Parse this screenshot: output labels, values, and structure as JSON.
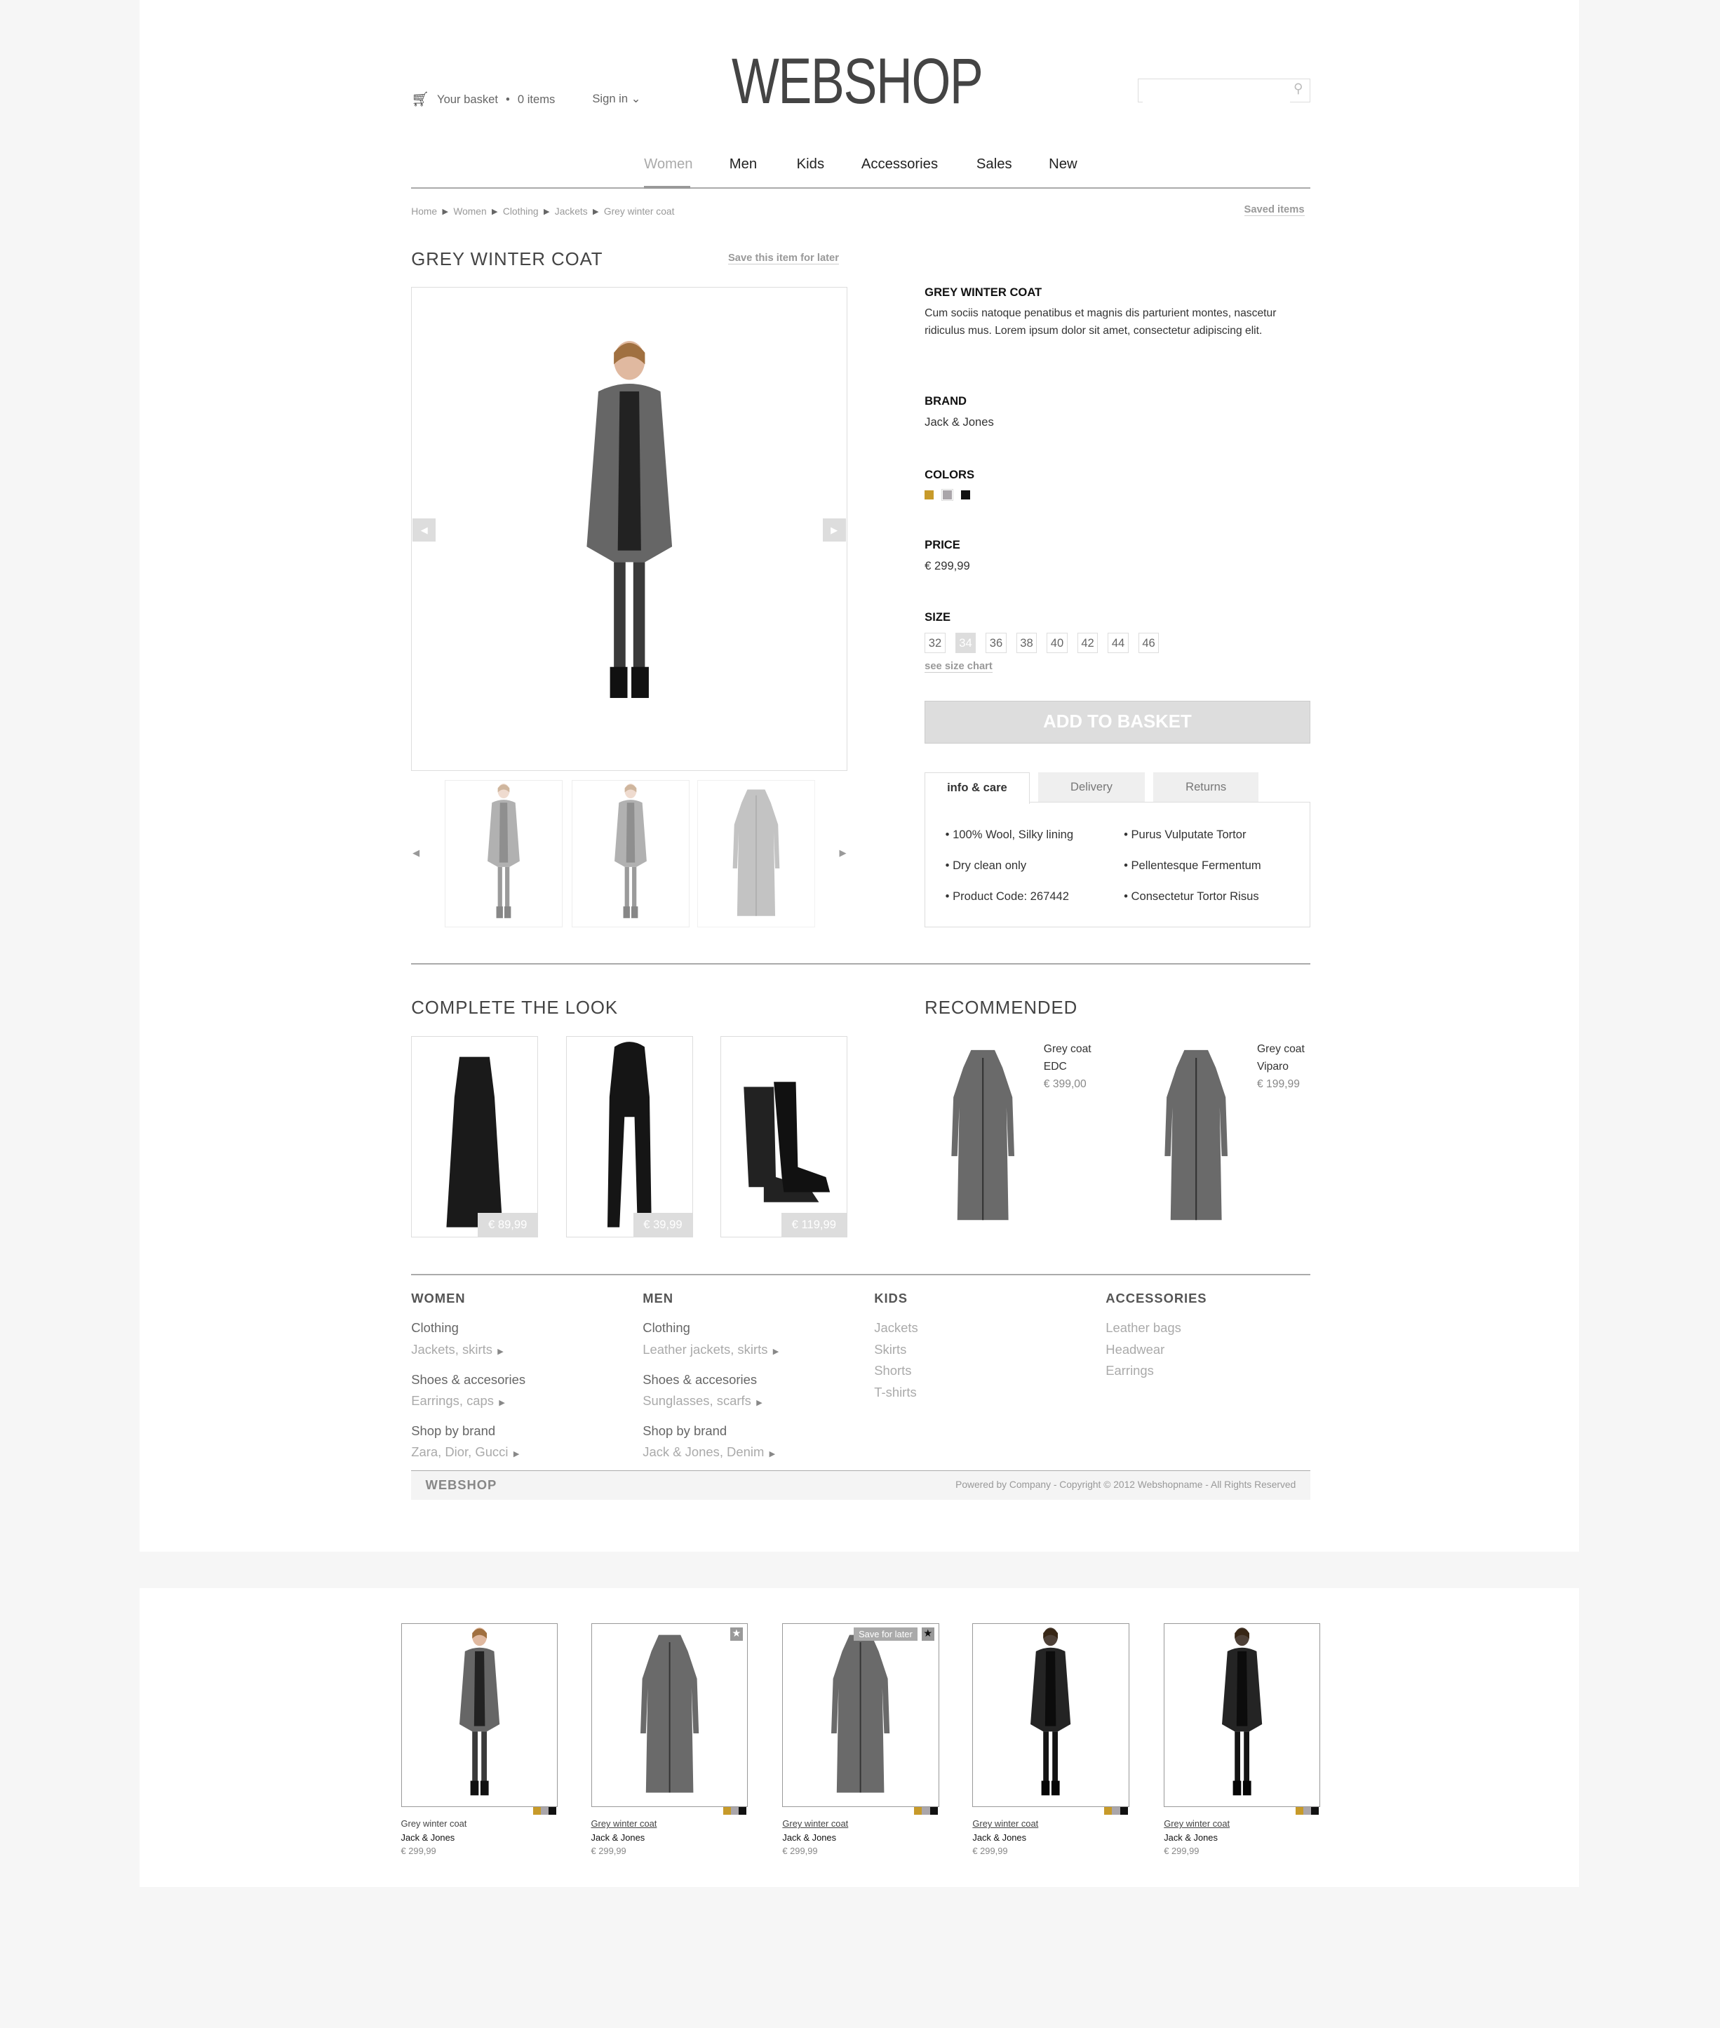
{
  "header": {
    "basket_label": "Your basket",
    "basket_count": "0 items",
    "sign_in": "Sign in",
    "logo": "WEBSHOP",
    "search_placeholder": ""
  },
  "nav": [
    {
      "label": "Women",
      "active": true
    },
    {
      "label": "Men"
    },
    {
      "label": "Kids"
    },
    {
      "label": "Accessories"
    },
    {
      "label": "Sales"
    },
    {
      "label": "New"
    }
  ],
  "breadcrumb": [
    "Home",
    "Women",
    "Clothing",
    "Jackets",
    "Grey winter coat"
  ],
  "saved_items": "Saved items",
  "product": {
    "title": "GREY WINTER COAT",
    "save_later": "Save this item for later",
    "detail_title": "GREY WINTER COAT",
    "description": "Cum sociis natoque penatibus et magnis dis parturient montes, nascetur ridiculus mus. Lorem ipsum dolor sit amet, consectetur adipiscing elit.",
    "brand_label": "BRAND",
    "brand": "Jack & Jones",
    "colors_label": "COLORS",
    "colors": [
      "#c79a2a",
      "#aaa6aa",
      "#111111"
    ],
    "selected_color": 1,
    "price_label": "PRICE",
    "price": "€ 299,99",
    "size_label": "SIZE",
    "sizes": [
      "32",
      "34",
      "36",
      "38",
      "40",
      "42",
      "44",
      "46"
    ],
    "selected_size": "34",
    "size_chart": "see size chart",
    "add_to_basket": "ADD TO BASKET",
    "prev_icon": "triangle-left",
    "next_icon": "triangle-right"
  },
  "tabs": {
    "items": [
      "info & care",
      "Delivery",
      "Returns"
    ],
    "active": 0,
    "info": [
      "100% Wool, Silky lining",
      "Dry clean only",
      "Product Code: 267442",
      "Purus Vulputate Tortor",
      "Pellentesque Fermentum",
      "Consectetur Tortor Risus"
    ]
  },
  "complete_look": {
    "title": "COMPLETE THE LOOK",
    "items": [
      {
        "price": "€ 89,99"
      },
      {
        "price": "€ 39,99"
      },
      {
        "price": "€ 119,99"
      }
    ]
  },
  "recommended": {
    "title": "RECOMMENDED",
    "items": [
      {
        "name": "Grey coat",
        "brand": "EDC",
        "price": "€ 399,00"
      },
      {
        "name": "Grey coat",
        "brand": "Viparo",
        "price": "€ 199,99"
      }
    ]
  },
  "footer": {
    "columns": [
      {
        "title": "WOMEN",
        "groups": [
          {
            "main": "Clothing",
            "sub": "Jackets, skirts"
          },
          {
            "main": "Shoes & accesories",
            "sub": "Earrings, caps"
          },
          {
            "main": "Shop by brand",
            "sub": "Zara, Dior, Gucci"
          }
        ]
      },
      {
        "title": "MEN",
        "groups": [
          {
            "main": "Clothing",
            "sub": "Leather jackets, skirts"
          },
          {
            "main": "Shoes & accesories",
            "sub": "Sunglasses, scarfs"
          },
          {
            "main": "Shop by brand",
            "sub": "Jack & Jones, Denim"
          }
        ]
      },
      {
        "title": "KIDS",
        "links": [
          "Jackets",
          "Skirts",
          "Shorts",
          "T-shirts"
        ]
      },
      {
        "title": "ACCESSORIES",
        "links": [
          "Leather bags",
          "Headwear",
          "Earrings"
        ]
      }
    ],
    "brand": "WEBSHOP",
    "copyright": "Powered by Company - Copyright © 2012 Webshopname - All Rights Reserved"
  },
  "listing": {
    "save_for_later": "Save for later",
    "items": [
      {
        "name": "Grey winter coat",
        "brand": "Jack & Jones",
        "price": "€ 299,99"
      },
      {
        "name": "Grey winter coat",
        "brand": "Jack & Jones",
        "price": "€ 299,99"
      },
      {
        "name": "Grey winter coat",
        "brand": "Jack & Jones",
        "price": "€ 299,99"
      },
      {
        "name": "Grey winter coat",
        "brand": "Jack & Jones",
        "price": "€ 299,99"
      },
      {
        "name": "Grey winter coat",
        "brand": "Jack & Jones",
        "price": "€ 299,99"
      }
    ]
  }
}
